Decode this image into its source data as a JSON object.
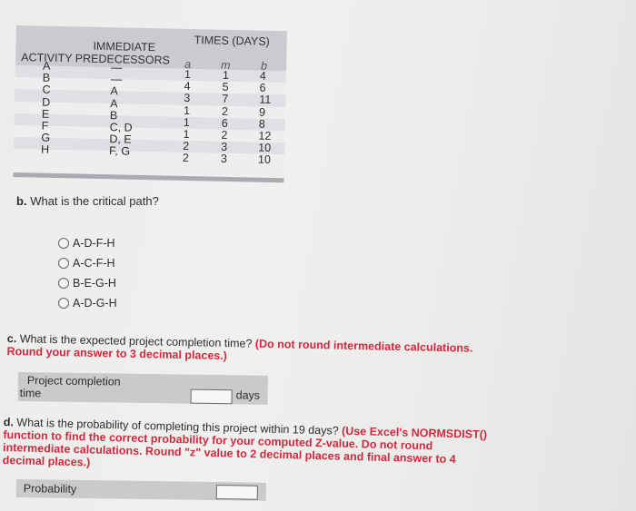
{
  "table": {
    "header_times": "TIMES (DAYS)",
    "header_immediate": "IMMEDIATE",
    "header_activity": "ACTIVITY PREDECESSORS",
    "col_a": "a",
    "col_m": "m",
    "col_b": "b",
    "rows": [
      {
        "activity": "A",
        "predecessors": "—",
        "a": "1",
        "m": "1",
        "b": "4"
      },
      {
        "activity": "B",
        "predecessors": "—",
        "a": "4",
        "m": "5",
        "b": "6"
      },
      {
        "activity": "C",
        "predecessors": "A",
        "a": "3",
        "m": "7",
        "b": "11"
      },
      {
        "activity": "D",
        "predecessors": "A",
        "a": "1",
        "m": "2",
        "b": "9"
      },
      {
        "activity": "E",
        "predecessors": "B",
        "a": "1",
        "m": "6",
        "b": "8"
      },
      {
        "activity": "F",
        "predecessors": "C, D",
        "a": "1",
        "m": "2",
        "b": "12"
      },
      {
        "activity": "G",
        "predecessors": "D, E",
        "a": "2",
        "m": "3",
        "b": "10"
      },
      {
        "activity": "H",
        "predecessors": "F, G",
        "a": "2",
        "m": "3",
        "b": "10"
      }
    ]
  },
  "question_b": {
    "label": "b.",
    "text": "What is the critical path?",
    "options": [
      "A-D-F-H",
      "A-C-F-H",
      "B-E-G-H",
      "A-D-G-H"
    ]
  },
  "question_c": {
    "label": "c.",
    "text": "What is the expected project completion time?",
    "instruction": "(Do not round intermediate calculations. Round your answer to 3 decimal places.)",
    "field_label_line1": "Project completion",
    "field_label_line2": "time",
    "field_value": "",
    "unit": "days"
  },
  "question_d": {
    "label": "d.",
    "text": "What is the probability of completing this project within 19 days?",
    "instruction": "(Use Excel's NORMSDIST() function to find the correct probability for your computed Z-value. Do not round intermediate calculations. Round \"z\" value to 2 decimal places and final answer to 4 decimal places.)",
    "field_label": "Probability",
    "field_value": ""
  }
}
